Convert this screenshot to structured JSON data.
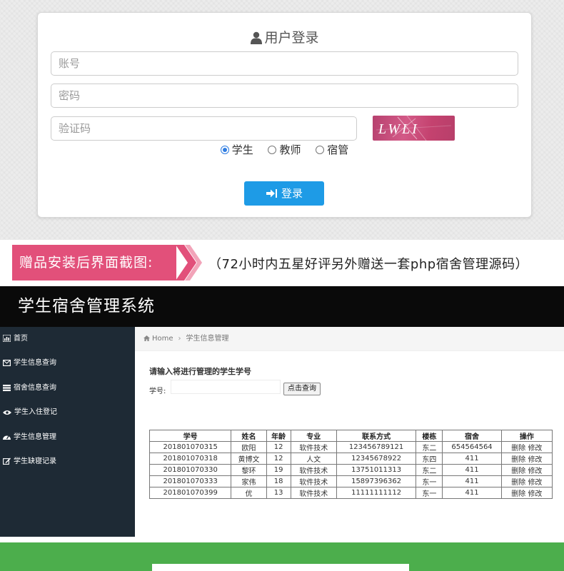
{
  "login": {
    "title": "用户登录",
    "account_placeholder": "账号",
    "password_placeholder": "密码",
    "captcha_placeholder": "验证码",
    "captcha_text": "LWLI",
    "roles": [
      "学生",
      "教师",
      "宿管"
    ],
    "selected_role": "学生",
    "login_label": "登录",
    "colors": {
      "button": "#1e9be6",
      "radio": "#2f7de1"
    }
  },
  "banner": {
    "label": "赠品安装后界面截图:",
    "text": "（72小时内五星好评另外赠送一套php宿舍管理源码）",
    "color": "#e2507a"
  },
  "app": {
    "title": "学生宿舍管理系统",
    "sidebar": [
      {
        "label": "首页",
        "icon": "bar-chart-icon"
      },
      {
        "label": "学生信息查询",
        "icon": "envelope-icon"
      },
      {
        "label": "宿舍信息查询",
        "icon": "list-icon"
      },
      {
        "label": "学生入住登记",
        "icon": "eye-icon"
      },
      {
        "label": "学生信息管理",
        "icon": "dashboard-icon"
      },
      {
        "label": "学生缺寝记录",
        "icon": "edit-icon"
      }
    ],
    "breadcrumb": {
      "home": "Home",
      "current": "学生信息管理"
    },
    "form": {
      "title": "请输入将进行管理的学生学号",
      "label": "学号:",
      "button": "点击查询"
    },
    "table": {
      "headers": [
        "学号",
        "姓名",
        "年龄",
        "专业",
        "联系方式",
        "楼栋",
        "宿舍",
        "操作"
      ],
      "rows": [
        [
          "201801070315",
          "欧阳",
          "12",
          "软件技术",
          "123456789121",
          "东二",
          "654564564"
        ],
        [
          "201801070318",
          "黄博文",
          "12",
          "人文",
          "12345678922",
          "东四",
          "411"
        ],
        [
          "201801070330",
          "黎环",
          "19",
          "软件技术",
          "13751011313",
          "东二",
          "411"
        ],
        [
          "201801070333",
          "家伟",
          "18",
          "软件技术",
          "15897396362",
          "东一",
          "411"
        ],
        [
          "201801070399",
          "优",
          "13",
          "软件技术",
          "11111111112",
          "东一",
          "411"
        ]
      ],
      "delete_label": "删除",
      "edit_label": "修改"
    }
  }
}
